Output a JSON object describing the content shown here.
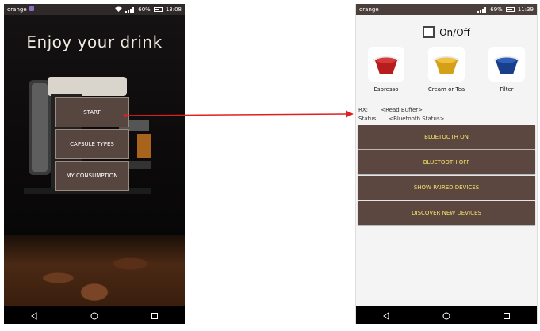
{
  "left_phone": {
    "status": {
      "carrier": "orange",
      "battery": "60%",
      "time": "13:08"
    },
    "title": "Enjoy your drink",
    "menu": [
      "START",
      "CAPSULE TYPES",
      "MY CONSUMPTION"
    ]
  },
  "right_phone": {
    "status": {
      "carrier": "orange",
      "battery": "69%",
      "time": "11:39"
    },
    "toggle_label": "On/Off",
    "capsules": [
      "Espresso",
      "Cream or Tea",
      "Filter"
    ],
    "rx_label": "RX:",
    "rx_value": "<Read Buffer>",
    "status_label": "Status:",
    "status_value": "<Bluetooth Status>",
    "buttons": [
      "BLUETOOTH ON",
      "BLUETOOTH OFF",
      "SHOW PAIRED DEVICES",
      "DISCOVER NEW DEVICES"
    ]
  },
  "colors": {
    "accent_brown": "#5b4640",
    "button_text": "#f5e36a",
    "arrow": "#e02020"
  }
}
